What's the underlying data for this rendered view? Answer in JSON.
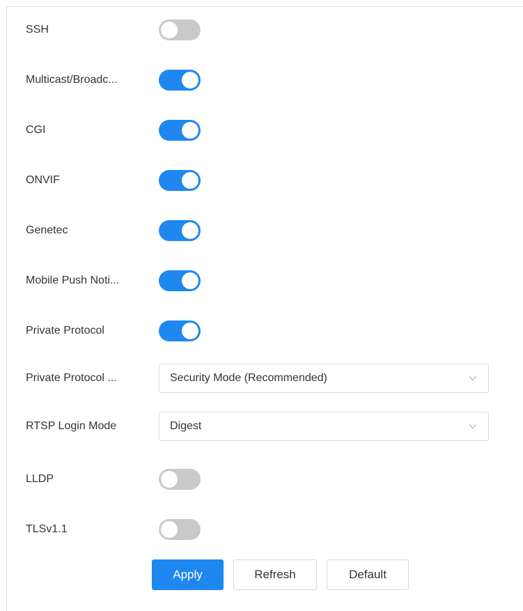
{
  "settings": {
    "ssh": {
      "label": "SSH",
      "enabled": false
    },
    "multicast": {
      "label": "Multicast/Broadc...",
      "enabled": true
    },
    "cgi": {
      "label": "CGI",
      "enabled": true
    },
    "onvif": {
      "label": "ONVIF",
      "enabled": true
    },
    "genetec": {
      "label": "Genetec",
      "enabled": true
    },
    "mobile_push": {
      "label": "Mobile Push Noti...",
      "enabled": true
    },
    "private_protocol": {
      "label": "Private Protocol",
      "enabled": true
    },
    "private_protocol_mode": {
      "label": "Private Protocol ...",
      "value": "Security Mode (Recommended)"
    },
    "rtsp_login_mode": {
      "label": "RTSP Login Mode",
      "value": "Digest"
    },
    "lldp": {
      "label": "LLDP",
      "enabled": false
    },
    "tlsv11": {
      "label": "TLSv1.1",
      "enabled": false
    }
  },
  "actions": {
    "apply_label": "Apply",
    "refresh_label": "Refresh",
    "default_label": "Default"
  },
  "colors": {
    "accent": "#1e88f0",
    "toggle_off": "#c9c9c9",
    "border": "#d9d9d9",
    "text": "#333333"
  }
}
